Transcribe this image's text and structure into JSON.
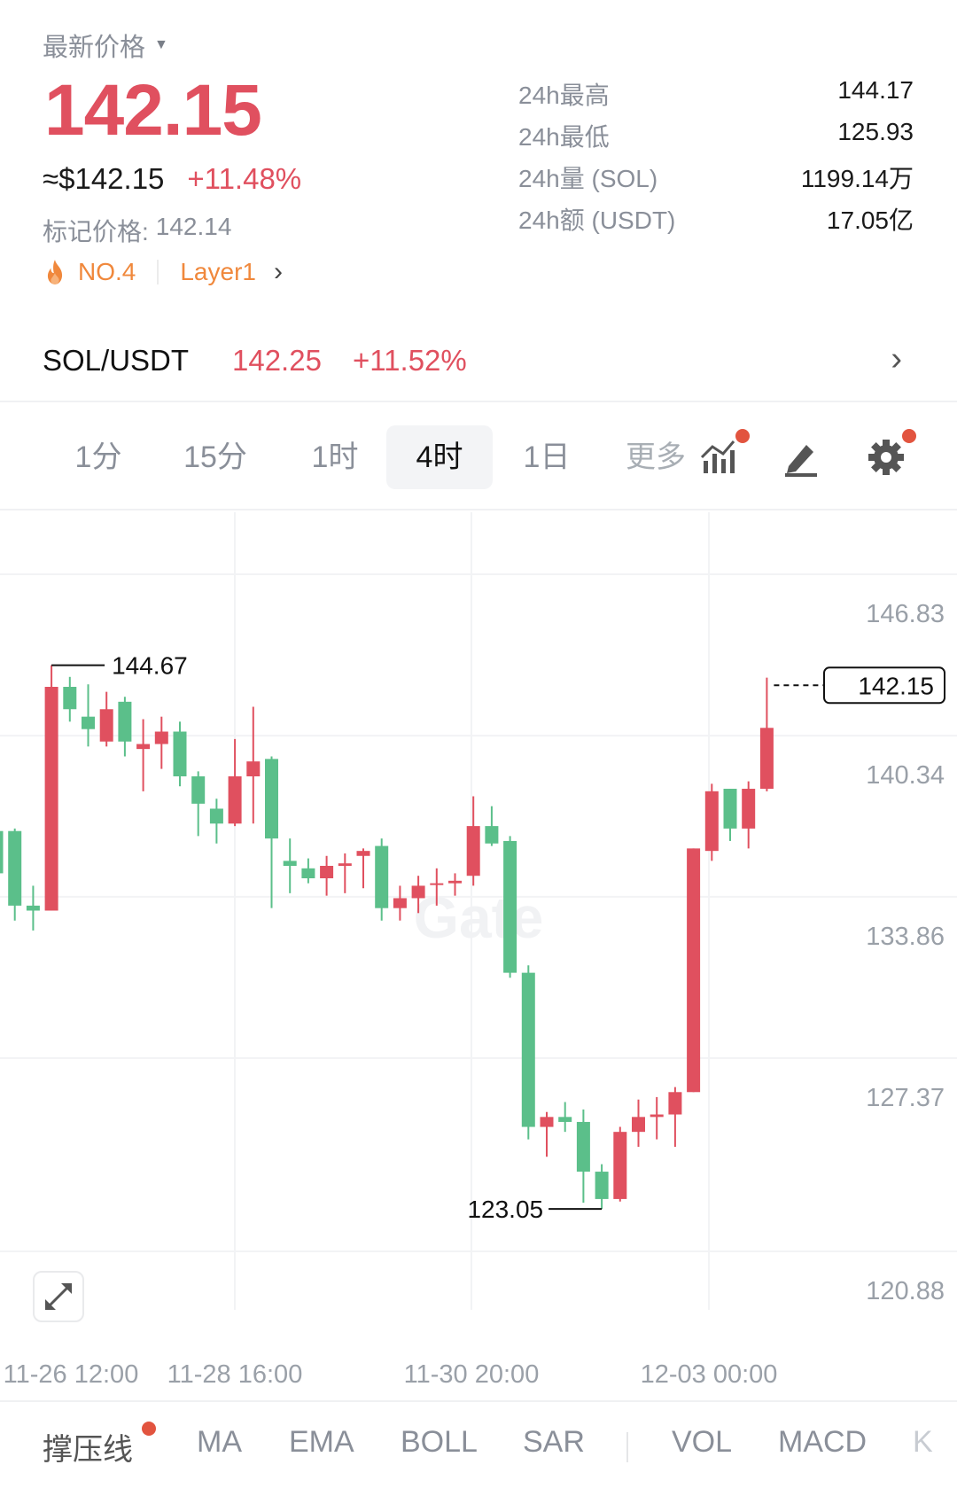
{
  "header": {
    "latest_label": "最新价格",
    "price": "142.15",
    "usd_price": "≈$142.15",
    "change_pct": "+11.48%",
    "mark_label": "标记价格:",
    "mark_price": "142.14",
    "rank": "NO.4",
    "category": "Layer1"
  },
  "stats": [
    {
      "label": "24h最高",
      "value": "144.17"
    },
    {
      "label": "24h最低",
      "value": "125.93"
    },
    {
      "label": "24h量 (SOL)",
      "value": "1199.14万"
    },
    {
      "label": "24h额 (USDT)",
      "value": "17.05亿"
    }
  ],
  "pair": {
    "symbol": "SOL/USDT",
    "price": "142.25",
    "change": "+11.52%"
  },
  "intervals": {
    "items": [
      "1分",
      "15分",
      "1时",
      "4时",
      "1日",
      "更多"
    ],
    "active": "4时"
  },
  "colors": {
    "up": "#e0505f",
    "down": "#5bbf8a",
    "accent_orange": "#f0883c",
    "dot_red": "#e2543f"
  },
  "chart_data": {
    "type": "candlestick",
    "y_ticks": [
      "146.83",
      "140.34",
      "133.86",
      "127.37",
      "120.88"
    ],
    "x_ticks": [
      "11-26 12:00",
      "11-28 16:00",
      "11-30 20:00",
      "12-03 00:00"
    ],
    "current_price_label": "142.15",
    "high_label": "144.67",
    "low_label": "123.05",
    "watermark": "Gate",
    "candles": [
      {
        "o": 138.0,
        "c": 136.3,
        "h": 138.2,
        "l": 135.9
      },
      {
        "o": 138.0,
        "c": 135.0,
        "h": 138.1,
        "l": 134.4
      },
      {
        "o": 135.0,
        "c": 134.8,
        "h": 135.8,
        "l": 134.0
      },
      {
        "o": 134.8,
        "c": 143.8,
        "h": 144.67,
        "l": 134.8
      },
      {
        "o": 143.8,
        "c": 142.9,
        "h": 144.2,
        "l": 142.4
      },
      {
        "o": 142.6,
        "c": 142.1,
        "h": 143.9,
        "l": 141.4
      },
      {
        "o": 141.6,
        "c": 142.9,
        "h": 143.6,
        "l": 141.4
      },
      {
        "o": 143.2,
        "c": 141.6,
        "h": 143.4,
        "l": 141.0
      },
      {
        "o": 141.3,
        "c": 141.5,
        "h": 142.5,
        "l": 139.6
      },
      {
        "o": 141.5,
        "c": 142.0,
        "h": 142.6,
        "l": 140.5
      },
      {
        "o": 142.0,
        "c": 140.2,
        "h": 142.4,
        "l": 139.8
      },
      {
        "o": 140.2,
        "c": 139.1,
        "h": 140.4,
        "l": 137.8
      },
      {
        "o": 138.9,
        "c": 138.3,
        "h": 139.3,
        "l": 137.5
      },
      {
        "o": 138.3,
        "c": 140.2,
        "h": 141.7,
        "l": 138.2
      },
      {
        "o": 140.2,
        "c": 140.8,
        "h": 143.0,
        "l": 138.3
      },
      {
        "o": 140.9,
        "c": 137.7,
        "h": 141.0,
        "l": 134.9
      },
      {
        "o": 136.8,
        "c": 136.6,
        "h": 137.7,
        "l": 135.5
      },
      {
        "o": 136.5,
        "c": 136.1,
        "h": 136.9,
        "l": 135.9
      },
      {
        "o": 136.1,
        "c": 136.6,
        "h": 137.0,
        "l": 135.4
      },
      {
        "o": 136.6,
        "c": 136.7,
        "h": 137.1,
        "l": 135.5
      },
      {
        "o": 137.0,
        "c": 137.2,
        "h": 137.3,
        "l": 135.7
      },
      {
        "o": 137.4,
        "c": 134.9,
        "h": 137.7,
        "l": 134.4
      },
      {
        "o": 134.9,
        "c": 135.3,
        "h": 135.8,
        "l": 134.4
      },
      {
        "o": 135.3,
        "c": 135.8,
        "h": 136.2,
        "l": 134.7
      },
      {
        "o": 135.9,
        "c": 135.9,
        "h": 136.5,
        "l": 135.0
      },
      {
        "o": 135.9,
        "c": 136.0,
        "h": 136.3,
        "l": 135.4
      },
      {
        "o": 136.2,
        "c": 138.2,
        "h": 139.4,
        "l": 135.8
      },
      {
        "o": 138.2,
        "c": 137.5,
        "h": 139.0,
        "l": 137.4
      },
      {
        "o": 137.6,
        "c": 132.3,
        "h": 137.8,
        "l": 132.1
      },
      {
        "o": 132.3,
        "c": 126.1,
        "h": 132.6,
        "l": 125.6
      },
      {
        "o": 126.1,
        "c": 126.5,
        "h": 126.7,
        "l": 124.9
      },
      {
        "o": 126.5,
        "c": 126.3,
        "h": 127.1,
        "l": 125.9
      },
      {
        "o": 126.3,
        "c": 124.3,
        "h": 126.8,
        "l": 123.05
      },
      {
        "o": 124.3,
        "c": 123.2,
        "h": 124.6,
        "l": 122.8
      },
      {
        "o": 123.2,
        "c": 125.9,
        "h": 126.1,
        "l": 123.1
      },
      {
        "o": 125.9,
        "c": 126.5,
        "h": 127.2,
        "l": 125.3
      },
      {
        "o": 126.5,
        "c": 126.6,
        "h": 127.3,
        "l": 125.6
      },
      {
        "o": 126.6,
        "c": 127.5,
        "h": 127.7,
        "l": 125.3
      },
      {
        "o": 127.5,
        "c": 137.3,
        "h": 137.3,
        "l": 127.5
      },
      {
        "o": 137.2,
        "c": 139.6,
        "h": 139.9,
        "l": 136.8
      },
      {
        "o": 139.7,
        "c": 138.1,
        "h": 139.7,
        "l": 137.6
      },
      {
        "o": 138.1,
        "c": 139.7,
        "h": 140.0,
        "l": 137.3
      },
      {
        "o": 139.7,
        "c": 142.15,
        "h": 144.17,
        "l": 139.6
      }
    ]
  },
  "indicators": [
    "撑压线",
    "MA",
    "EMA",
    "BOLL",
    "SAR",
    "VOL",
    "MACD",
    "K"
  ]
}
